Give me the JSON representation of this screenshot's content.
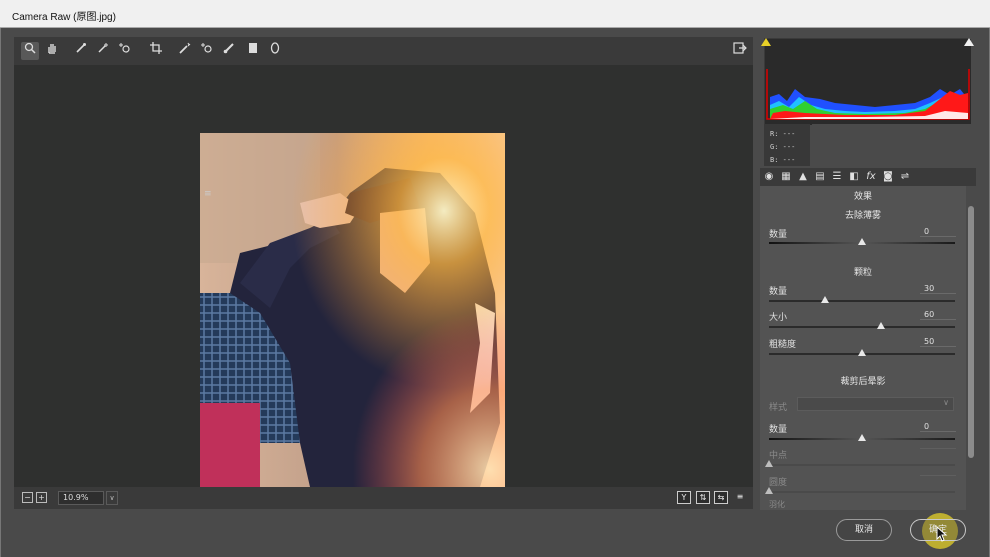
{
  "window": {
    "title": "Camera Raw (原图.jpg)"
  },
  "toolbar": {
    "tools": [
      {
        "name": "zoom-tool-icon",
        "glyph": "🔍",
        "active": true
      },
      {
        "name": "hand-tool-icon",
        "glyph": "✋"
      },
      {
        "name": "white-balance-tool-icon",
        "glyph": "⟋"
      },
      {
        "name": "color-sampler-tool-icon",
        "glyph": "⟋"
      },
      {
        "name": "target-adjustment-tool-icon",
        "glyph": "⊙"
      },
      {
        "name": "crop-tool-icon",
        "glyph": "⌗"
      },
      {
        "name": "spot-removal-tool-icon",
        "glyph": "⟋"
      },
      {
        "name": "red-eye-tool-icon",
        "glyph": "+"
      },
      {
        "name": "adjustment-brush-icon",
        "glyph": "⟋"
      },
      {
        "name": "graduated-filter-icon",
        "glyph": "▮"
      },
      {
        "name": "radial-filter-icon",
        "glyph": "O"
      }
    ],
    "export_icon": "export-icon"
  },
  "statusbar": {
    "zoom_value": "10.9%",
    "right_buttons": [
      "Y",
      "⇅",
      "⇆",
      "≡"
    ]
  },
  "histogram": {
    "clip_shadow_color": "#e8d028",
    "clip_highlight_color": "#ffffff"
  },
  "rgb_readout": {
    "r": "R: ---",
    "g": "G: ---",
    "b": "B: ---"
  },
  "panel_tabs": [
    "◉",
    "▦",
    "▲",
    "▤",
    "☰",
    "◧",
    "fx",
    "◙",
    "⇌"
  ],
  "panel": {
    "title": "效果",
    "dehaze": {
      "heading": "去除薄雾",
      "amount_label": "数量",
      "amount_value": "0",
      "amount_fraction": 0.5
    },
    "grain": {
      "heading": "颗粒",
      "amount_label": "数量",
      "amount_value": "30",
      "amount_fraction": 0.3,
      "size_label": "大小",
      "size_value": "60",
      "size_fraction": 0.6,
      "roughness_label": "粗糙度",
      "roughness_value": "50",
      "roughness_fraction": 0.5
    },
    "vignette": {
      "heading": "裁剪后晕影",
      "style_label": "样式",
      "style_value": "",
      "amount_label": "数量",
      "amount_value": "0",
      "amount_fraction": 0.5,
      "midpoint_label": "中点",
      "midpoint_fraction": 0.0,
      "roundness_label": "圆度",
      "roundness_fraction": 0.0,
      "feather_label": "羽化"
    }
  },
  "buttons": {
    "cancel": "取消",
    "ok": "确定"
  },
  "colors": {
    "accent_yellow": "#e4d028"
  }
}
